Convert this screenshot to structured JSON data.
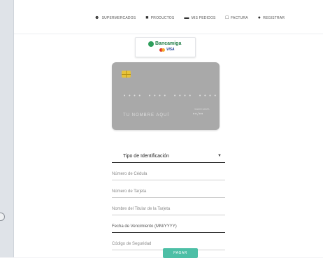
{
  "nav": {
    "items": [
      {
        "label": "Supermercados",
        "icon": "people-icon"
      },
      {
        "label": "Productos",
        "icon": "box-icon"
      },
      {
        "label": "Mis pedidos",
        "icon": "truck-icon"
      },
      {
        "label": "Factura",
        "icon": "receipt-icon"
      },
      {
        "label": "Registrar",
        "icon": "user-plus-icon"
      }
    ]
  },
  "logo": {
    "text": "Bancamiga",
    "card_brand": "VISA"
  },
  "card": {
    "number": "•••• •••• •••• ••••",
    "holder": "TU NOMBRE AQUÍ",
    "exp_label": "Valido hasta",
    "exp": "••/••"
  },
  "form": {
    "id_type_select": "Tipo de Identificación",
    "cedula_placeholder": "Número de Cédula",
    "card_number_placeholder": "Número de Tarjeta",
    "holder_placeholder": "Nombre del Titular de la Tarjeta",
    "expiry_placeholder": "Fecha de Vencimiento (MM/YYYY)",
    "cvv_placeholder": "Código de Seguridad",
    "pay_label": "Pagar"
  },
  "colors": {
    "accent": "#4dbfa6",
    "card": "#a9a9a9",
    "chip": "#e6c23a"
  }
}
